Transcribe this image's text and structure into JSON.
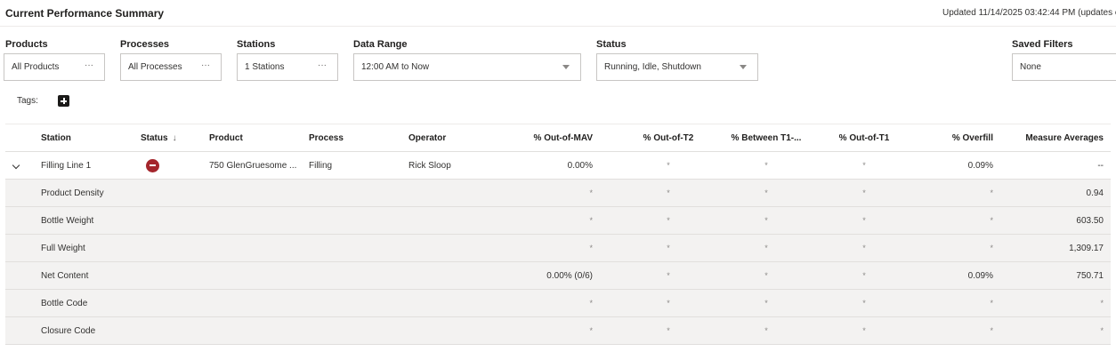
{
  "header": {
    "title": "Current Performance Summary",
    "updated": "Updated 11/14/2025 03:42:44 PM (updates e"
  },
  "filters": {
    "products": {
      "label": "Products",
      "value": "All Products",
      "more": "···"
    },
    "processes": {
      "label": "Processes",
      "value": "All Processes",
      "more": "···"
    },
    "stations": {
      "label": "Stations",
      "value": "1 Stations",
      "more": "···"
    },
    "data_range": {
      "label": "Data Range",
      "value": "12:00 AM to Now"
    },
    "status": {
      "label": "Status",
      "value": "Running, Idle, Shutdown"
    },
    "saved": {
      "label": "Saved Filters",
      "value": "None"
    }
  },
  "tags": {
    "label": "Tags:"
  },
  "table": {
    "columns": {
      "station": "Station",
      "status": "Status",
      "status_sort": "↓",
      "product": "Product",
      "process": "Process",
      "operator": "Operator",
      "out_mav": "% Out-of-MAV",
      "out_t2": "% Out-of-T2",
      "between_t1": "% Between T1-...",
      "out_t1": "% Out-of-T1",
      "overfill": "% Overfill",
      "averages": "Measure Averages"
    },
    "station_row": {
      "station": "Filling Line 1",
      "product": "750 GlenGruesome ...",
      "process": "Filling",
      "operator": "Rick Sloop",
      "out_mav": "0.00%",
      "out_t2": "*",
      "between_t1": "*",
      "out_t1": "*",
      "overfill": "0.09%",
      "averages": "--"
    },
    "children": [
      {
        "name": "Product Density",
        "out_mav": "*",
        "out_t2": "*",
        "between_t1": "*",
        "out_t1": "*",
        "overfill": "*",
        "averages": "0.94"
      },
      {
        "name": "Bottle Weight",
        "out_mav": "*",
        "out_t2": "*",
        "between_t1": "*",
        "out_t1": "*",
        "overfill": "*",
        "averages": "603.50"
      },
      {
        "name": "Full Weight",
        "out_mav": "*",
        "out_t2": "*",
        "between_t1": "*",
        "out_t1": "*",
        "overfill": "*",
        "averages": "1,309.17"
      },
      {
        "name": "Net Content",
        "out_mav": "0.00% (0/6)",
        "out_t2": "*",
        "between_t1": "*",
        "out_t1": "*",
        "overfill": "0.09%",
        "averages": "750.71"
      },
      {
        "name": "Bottle Code",
        "out_mav": "*",
        "out_t2": "*",
        "between_t1": "*",
        "out_t1": "*",
        "overfill": "*",
        "averages": "*"
      },
      {
        "name": "Closure Code",
        "out_mav": "*",
        "out_t2": "*",
        "between_t1": "*",
        "out_t1": "*",
        "overfill": "*",
        "averages": "*"
      }
    ]
  },
  "colors": {
    "status_shutdown": "#a4262c",
    "row_shade": "#f3f2f1",
    "border": "#e1dfdd"
  },
  "icons": {
    "expand": "chevron-down-icon",
    "status": "shutdown-status-icon",
    "tags_add": "plus-icon",
    "dropdown": "caret-down-icon",
    "more": "ellipsis-icon"
  }
}
